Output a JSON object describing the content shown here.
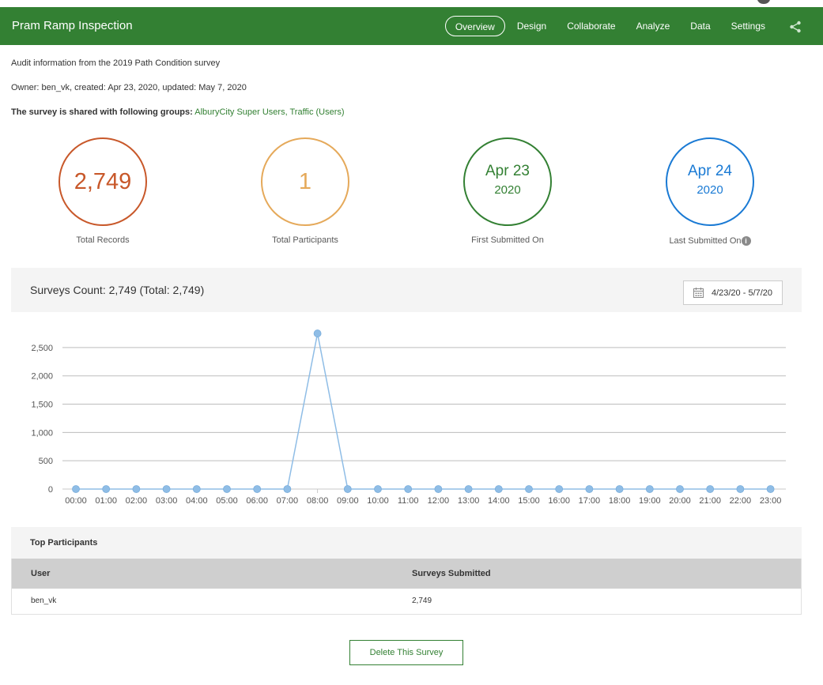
{
  "header": {
    "title": "Pram Ramp Inspection",
    "nav": [
      "Overview",
      "Design",
      "Collaborate",
      "Analyze",
      "Data",
      "Settings"
    ],
    "active_tab": "Overview",
    "brand_color": "#338033"
  },
  "info": {
    "description": "Audit information from the 2019 Path Condition survey",
    "owner_line": "Owner: ben_vk, created: Apr 23, 2020, updated: May 7, 2020",
    "shared_prefix": "The survey is shared with following groups:",
    "shared_groups": "AlburyCity Super Users, Traffic (Users)"
  },
  "stats": {
    "total_records": {
      "value": "2,749",
      "label": "Total Records",
      "color": "#c8582a"
    },
    "total_participants": {
      "value": "1",
      "label": "Total Participants",
      "color": "#e5a95a"
    },
    "first_submitted": {
      "date": "Apr 23",
      "year": "2020",
      "label": "First Submitted On",
      "color": "#338033"
    },
    "last_submitted": {
      "date": "Apr 24",
      "year": "2020",
      "label": "Last Submitted On",
      "color": "#1a7ad4"
    }
  },
  "chart_section": {
    "title": "Surveys Count: 2,749 (Total: 2,749)",
    "date_range": "4/23/20 - 5/7/20"
  },
  "chart_data": {
    "type": "line",
    "categories": [
      "00:00",
      "01:00",
      "02:00",
      "03:00",
      "04:00",
      "05:00",
      "06:00",
      "07:00",
      "08:00",
      "09:00",
      "10:00",
      "11:00",
      "12:00",
      "13:00",
      "14:00",
      "15:00",
      "16:00",
      "17:00",
      "18:00",
      "19:00",
      "20:00",
      "21:00",
      "22:00",
      "23:00"
    ],
    "values": [
      0,
      0,
      0,
      0,
      0,
      0,
      0,
      0,
      2749,
      0,
      0,
      0,
      0,
      0,
      0,
      0,
      0,
      0,
      0,
      0,
      0,
      0,
      0,
      0
    ],
    "yticks": [
      0,
      500,
      1000,
      1500,
      2000,
      2500
    ],
    "ytick_labels": [
      "0",
      "500",
      "1,000",
      "1,500",
      "2,000",
      "2,500"
    ],
    "ylim": [
      0,
      2750
    ],
    "grid": true,
    "color": "#8fbde6"
  },
  "top_participants": {
    "title": "Top Participants",
    "columns": [
      "User",
      "Surveys Submitted"
    ],
    "rows": [
      [
        "ben_vk",
        "2,749"
      ]
    ]
  },
  "actions": {
    "delete_label": "Delete This Survey"
  }
}
